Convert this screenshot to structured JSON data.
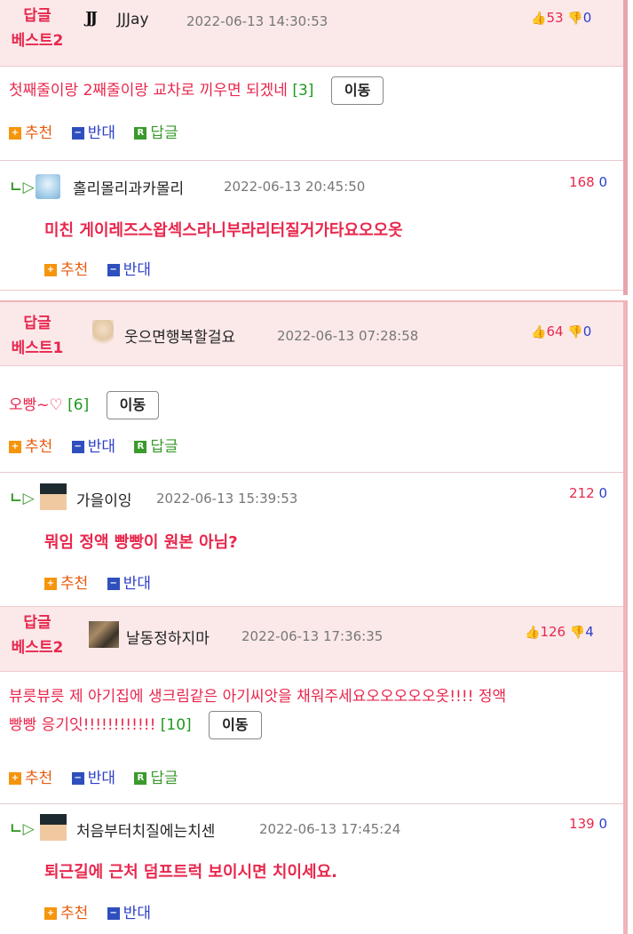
{
  "comments": [
    {
      "best_label_1": "답글",
      "best_label_2": "베스트2",
      "username": "JJJay",
      "date": "2022-06-13 14:30:53",
      "up": "53",
      "down": "0",
      "text": "첫째줄이랑 2째줄이랑 교차로 끼우면 되겠네",
      "reply_count": "[3]",
      "move_label": "이동",
      "actions": {
        "recommend": "추천",
        "oppose": "반대",
        "reply": "답글"
      },
      "reply": {
        "username": "홀리몰리과카몰리",
        "date": "2022-06-13 20:45:50",
        "up": "168",
        "down": "0",
        "text": "미친 게이레즈스왑섹스라니부라리터질거가타요오오옷",
        "actions": {
          "recommend": "추천",
          "oppose": "반대"
        }
      }
    },
    {
      "best_label_1": "답글",
      "best_label_2": "베스트1",
      "username": "웃으면행복할걸요",
      "date": "2022-06-13 07:28:58",
      "up": "64",
      "down": "0",
      "text": "오빵~♡",
      "reply_count": "[6]",
      "move_label": "이동",
      "actions": {
        "recommend": "추천",
        "oppose": "반대",
        "reply": "답글"
      },
      "reply": {
        "username": "가을이잉",
        "date": "2022-06-13 15:39:53",
        "up": "212",
        "down": "0",
        "text": "뭐임 정액 빵빵이 원본 아님?",
        "actions": {
          "recommend": "추천",
          "oppose": "반대"
        }
      }
    },
    {
      "best_label_1": "답글",
      "best_label_2": "베스트2",
      "username": "날동정하지마",
      "date": "2022-06-13 17:36:35",
      "up": "126",
      "down": "4",
      "text_line1": "뷰릇뷰릇 제 아기집에 생크림같은 아기씨앗을 채워주세요오오오오오옷!!!! 정액",
      "text_line2": "빵빵 응기잇!!!!!!!!!!!!",
      "reply_count": "[10]",
      "move_label": "이동",
      "actions": {
        "recommend": "추천",
        "oppose": "반대",
        "reply": "답글"
      },
      "reply": {
        "username": "처음부터치질에는치센",
        "date": "2022-06-13 17:45:24",
        "up": "139",
        "down": "0",
        "text": "퇴근길에 근처 덤프트럭 보이시면 치이세요.",
        "actions": {
          "recommend": "추천",
          "oppose": "반대"
        }
      }
    }
  ],
  "icons": {
    "thumbs_up": "thumbs-up-icon",
    "thumbs_down": "thumbs-down-icon",
    "reply_arrow": "reply-arrow-icon"
  },
  "colors": {
    "best_red": "#e8274d",
    "down_blue": "#2c3fc9",
    "reply_green": "#3a9a2c",
    "header_bg": "#fbe9ea"
  }
}
